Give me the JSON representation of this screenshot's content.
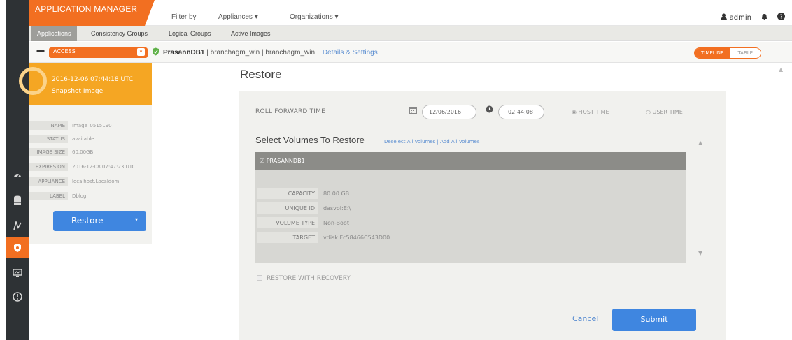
{
  "brand": {
    "title": "APPLICATION MANAGER"
  },
  "topnav": {
    "filter_by": "Filter by",
    "appliances": "Appliances ▾",
    "organizations": "Organizations ▾"
  },
  "user": {
    "name": "admin"
  },
  "subnav": {
    "tabs": [
      {
        "label": "Applications",
        "active": true
      },
      {
        "label": "Consistency Groups",
        "active": false
      },
      {
        "label": "Logical Groups",
        "active": false
      },
      {
        "label": "Active Images",
        "active": false
      }
    ]
  },
  "appbar": {
    "access": "ACCESS",
    "app_name": "PrasannDB1",
    "host1": "branchagm_win",
    "host2": "branchagm_win",
    "separator": "|",
    "details_link": "Details & Settings",
    "view_on": "TIMELINE",
    "view_off": "TABLE"
  },
  "snapshot": {
    "date": "2016-12-06 07:44:18 UTC",
    "kind": "Snapshot Image",
    "fields": [
      {
        "k": "NAME",
        "v": "Image_0515190"
      },
      {
        "k": "STATUS",
        "v": "available"
      },
      {
        "k": "IMAGE SIZE",
        "v": "60.00GB"
      },
      {
        "k": "EXPIRES ON",
        "v": "2016-12-08 07:47:23 UTC"
      },
      {
        "k": "APPLIANCE",
        "v": "localhost.Localdom"
      },
      {
        "k": "LABEL",
        "v": "Dblog"
      }
    ],
    "restore_label": "Restore"
  },
  "restore": {
    "title": "Restore",
    "roll_forward_label": "ROLL FORWARD TIME",
    "date_value": "12/06/2016",
    "time_value": "02:44:08",
    "host_time": "HOST TIME",
    "user_time": "USER TIME",
    "select_title": "Select Volumes To Restore",
    "deselect_all": "Deselect All Volumes",
    "link_sep": "|",
    "add_all": "Add All Volumes",
    "volume_name": "PRASANNDB1",
    "volume_fields": [
      {
        "k": "CAPACITY",
        "v": "80.00 GB"
      },
      {
        "k": "UNIQUE ID",
        "v": "dasvol:E:\\"
      },
      {
        "k": "VOLUME TYPE",
        "v": "Non-Boot"
      },
      {
        "k": "TARGET",
        "v": "vdisk:Fc58466C543D00"
      }
    ],
    "recovery_label": "RESTORE WITH RECOVERY",
    "cancel": "Cancel",
    "submit": "Submit"
  },
  "colors": {
    "brand": "#f26f21",
    "snapshot": "#f5a623",
    "primary_button": "#3f86e0",
    "link": "#5b8ed1",
    "sidebar": "#2e3235"
  },
  "icons": [
    "dashboard-icon",
    "database-icon",
    "workflow-icon",
    "shield-icon",
    "monitor-icon",
    "info-icon",
    "user-icon",
    "bell-icon",
    "help-icon",
    "calendar-icon",
    "clock-icon",
    "swap-icon"
  ]
}
